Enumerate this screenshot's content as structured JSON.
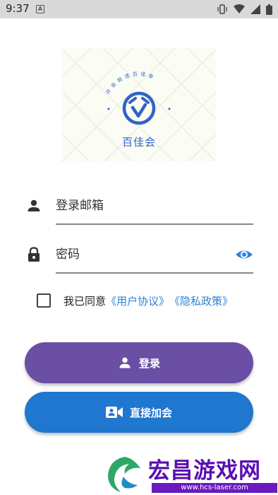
{
  "status_bar": {
    "time": "9:37",
    "notification_glyph": "A"
  },
  "logo": {
    "arc_text": "开会就选百佳会",
    "title": "百佳会"
  },
  "form": {
    "email_placeholder": "登录邮箱",
    "password_placeholder": "密码"
  },
  "agreement": {
    "prefix": "我已同意",
    "user_agreement": "《用户协议》",
    "privacy_policy": "《隐私政策》"
  },
  "buttons": {
    "login_label": "登录",
    "join_label": "直接加会"
  },
  "watermark": {
    "text": "宏昌游戏网",
    "url": "www.hcs-laser.com"
  },
  "colors": {
    "login_button": "#6a4fa4",
    "join_button": "#1f77cf",
    "link": "#2c84d8",
    "logo_blue": "#2f63c8"
  },
  "icons": {
    "email_field": "person-icon",
    "password_field": "lock-icon",
    "visibility": "eye-icon",
    "login_button": "person-icon",
    "join_button": "video-camera-icon"
  }
}
